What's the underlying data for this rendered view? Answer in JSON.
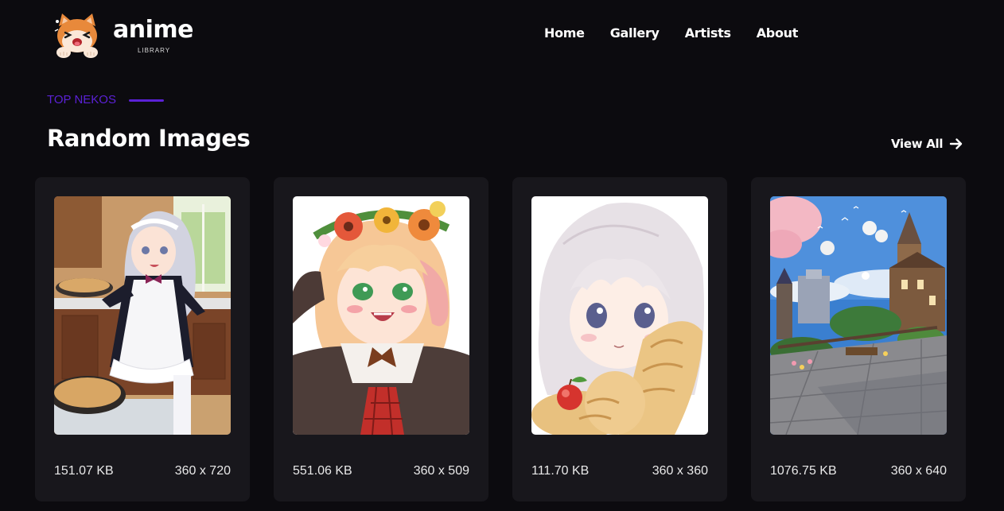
{
  "brand": {
    "word": "anime",
    "sub": "LIBRARY",
    "logo_icon": "shiba-dog-mascot-icon"
  },
  "nav": {
    "items": [
      {
        "label": "Home"
      },
      {
        "label": "Gallery"
      },
      {
        "label": "Artists"
      },
      {
        "label": "About"
      }
    ]
  },
  "section": {
    "eyebrow": "TOP NEKOS",
    "title": "Random Images",
    "view_all": "View All",
    "view_all_icon": "arrow-right-icon"
  },
  "cards": [
    {
      "size": "151.07 KB",
      "dimensions": "360 x 720",
      "image": "maid-girl-cooking-illustration"
    },
    {
      "size": "551.06 KB",
      "dimensions": "360 x 509",
      "image": "flower-crown-girl-illustration"
    },
    {
      "size": "111.70 KB",
      "dimensions": "360 x 360",
      "image": "white-haired-girl-with-bread-illustration"
    },
    {
      "size": "1076.75 KB",
      "dimensions": "360 x 640",
      "image": "fantasy-town-balloons-illustration"
    }
  ],
  "colors": {
    "background": "#0c0b0f",
    "card": "#18171c",
    "accent": "#5b21d6",
    "text": "#ffffff"
  }
}
